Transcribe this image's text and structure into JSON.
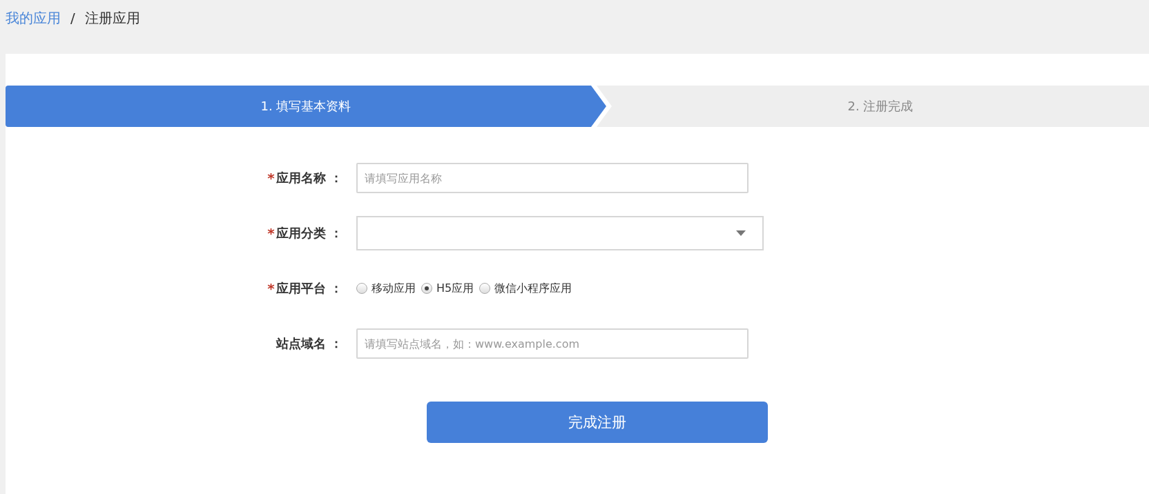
{
  "breadcrumb": [
    {
      "label": "我的应用",
      "kind": "link"
    },
    {
      "label": "注册应用",
      "kind": "current"
    }
  ],
  "breadcrumb_separator": "/",
  "steps": [
    {
      "label": "1. 填写基本资料",
      "selected": true
    },
    {
      "label": "2. 注册完成",
      "selected": false
    }
  ],
  "required_mark": "*",
  "fields": [
    {
      "kind": "text",
      "label": "应用名称 ：",
      "required": true,
      "placeholder": "请填写应用名称"
    },
    {
      "kind": "select",
      "label": "应用分类 ：",
      "required": true
    },
    {
      "kind": "radio",
      "label": "应用平台 ：",
      "required": true,
      "options": [
        {
          "label": "移动应用",
          "selected": false
        },
        {
          "label": "H5应用",
          "selected": true
        },
        {
          "label": "微信小程序应用",
          "selected": false
        }
      ]
    },
    {
      "kind": "text",
      "label": "站点域名 ：",
      "required": false,
      "placeholder": "请填写站点域名，如：www.example.com"
    }
  ],
  "submit": "完成注册"
}
